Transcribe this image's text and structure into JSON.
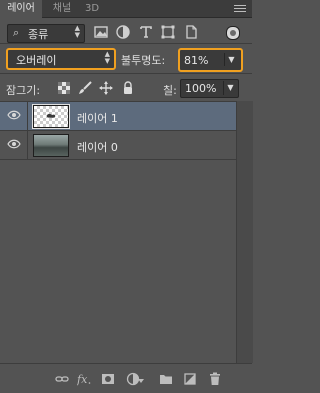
{
  "tabs": [
    {
      "label": "레이어",
      "active": true
    },
    {
      "label": "채널",
      "active": false
    },
    {
      "label": "3D",
      "active": false
    }
  ],
  "filter": {
    "kind_label": "종류",
    "icons": [
      "image-filter-icon",
      "adjustment-filter-icon",
      "type-filter-icon",
      "shape-filter-icon",
      "smart-object-filter-icon"
    ]
  },
  "blend": {
    "mode": "오버레이",
    "opacity_label": "불투명도:",
    "opacity_value": "81%"
  },
  "lock": {
    "label": "잠그기:",
    "fill_label": "칠:",
    "fill_value": "100%"
  },
  "layers": [
    {
      "name": "레이어 1",
      "selected": true,
      "visible": true
    },
    {
      "name": "레이어 0",
      "selected": false,
      "visible": true
    }
  ],
  "colors": {
    "panel_bg": "#535353",
    "selected_row": "#5d6b7d",
    "highlight_outline": "#f0a020"
  }
}
